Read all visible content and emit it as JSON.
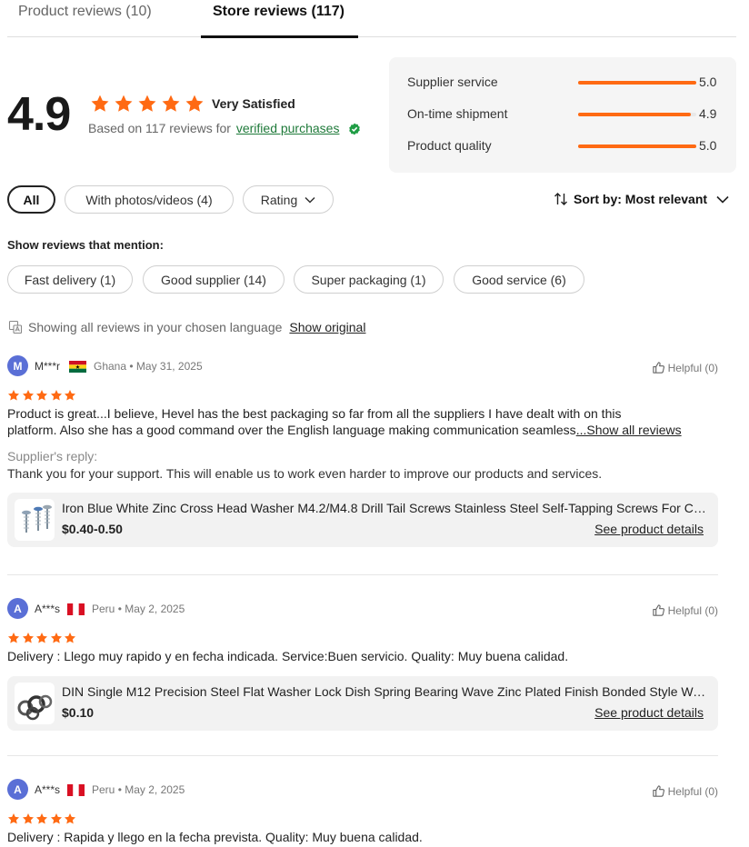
{
  "tabs": [
    {
      "label": "Product reviews (10)"
    },
    {
      "label": "Store reviews (117)"
    }
  ],
  "summary": {
    "rating": "4.9",
    "satisfaction": "Very Satisfied",
    "based_on": "Based on 117 reviews for",
    "verified_label": "verified purchases",
    "star_color": "#FF6A13"
  },
  "metrics": [
    {
      "label": "Supplier service",
      "value": "5.0",
      "level": 1.0
    },
    {
      "label": "On-time shipment",
      "value": "4.9",
      "level": 0.95
    },
    {
      "label": "Product quality",
      "value": "5.0",
      "level": 1.0
    }
  ],
  "filters": {
    "all": "All",
    "photos": "With photos/videos (4)",
    "rating": "Rating",
    "sort": "Sort by: Most relevant"
  },
  "mentions": {
    "title": "Show reviews that mention:",
    "tags": [
      "Fast delivery (1)",
      "Good supplier (14)",
      "Super packaging (1)",
      "Good service (6)"
    ]
  },
  "language": {
    "text": "Showing all reviews in your chosen language",
    "link": "Show original"
  },
  "reviews": [
    {
      "initial": "M",
      "name": "M***r",
      "country": "Ghana",
      "date": "May 31, 2025",
      "helpful": "Helpful (0)",
      "stars": 5,
      "text1": "Product is great...I believe, Hevel has the best packaging so far from all the suppliers I have dealt with on this",
      "text2": "platform. Also she has a good command over the English language making communication seamless",
      "show_all": "...Show all reviews",
      "reply_title": "Supplier's reply:",
      "reply_text": "Thank you for your support. This will enable us to work even harder to improve our products and services.",
      "product": {
        "title": "Iron Blue White Zinc Cross Head Washer M4.2/M4.8 Drill Tail Screws Stainless Steel Self-Tapping Screws For Construction",
        "price": "$0.40-0.50",
        "link": "See product details"
      }
    },
    {
      "initial": "A",
      "name": "A***s",
      "country": "Peru",
      "date": "May 2, 2025",
      "helpful": "Helpful (0)",
      "stars": 5,
      "text1": "Delivery : Llego muy rapido y en fecha indicada. Service:Buen servicio. Quality: Muy buena calidad.",
      "product": {
        "title": "DIN Single M12 Precision Steel Flat Washer Lock Dish Spring Bearing Wave Zinc Plated Finish Bonded Style Washers",
        "price": "$0.10",
        "link": "See product details"
      }
    },
    {
      "initial": "A",
      "name": "A***s",
      "country": "Peru",
      "date": "May 2, 2025",
      "helpful": "Helpful (0)",
      "stars": 5,
      "text1": "Delivery : Rapida y llego en la fecha prevista. Quality: Muy buena calidad."
    }
  ]
}
